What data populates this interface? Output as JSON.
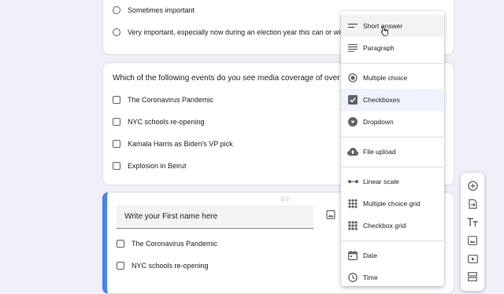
{
  "card1": {
    "options": [
      "Sometimes important",
      "Very important, especially now during an election year this can or will affe"
    ]
  },
  "card2": {
    "question": "Which of the following events do you see media coverage of over the",
    "options": [
      "The Coronavirus Pandemic",
      "NYC schools re-opening",
      "Kamala Harris as Biden's VP pick",
      "Explosion in Beirut"
    ]
  },
  "card3": {
    "drag_handle": "⠿⠿",
    "question_value": "Write your First name here",
    "options": [
      "The Coronavirus Pandemic",
      "NYC schools re-opening"
    ]
  },
  "type_menu": {
    "items": [
      {
        "label": "Short answer",
        "icon": "short-answer-icon"
      },
      {
        "label": "Paragraph",
        "icon": "paragraph-icon"
      },
      {
        "label": "Multiple choice",
        "icon": "radio-icon"
      },
      {
        "label": "Checkboxes",
        "icon": "checkbox-icon"
      },
      {
        "label": "Dropdown",
        "icon": "dropdown-icon"
      },
      {
        "label": "File upload",
        "icon": "upload-icon"
      },
      {
        "label": "Linear scale",
        "icon": "linear-scale-icon"
      },
      {
        "label": "Multiple choice grid",
        "icon": "grid-icon"
      },
      {
        "label": "Checkbox grid",
        "icon": "grid-icon"
      },
      {
        "label": "Date",
        "icon": "calendar-icon"
      },
      {
        "label": "Time",
        "icon": "clock-icon"
      }
    ],
    "selected": "Checkboxes",
    "hovered": "Short answer"
  },
  "side_toolbar": {
    "buttons": [
      "add-question-icon",
      "import-questions-icon",
      "add-title-icon",
      "add-image-icon",
      "add-video-icon",
      "add-section-icon"
    ]
  },
  "colors": {
    "background": "#f1eef8",
    "accent": "#4285f4",
    "icon": "#5f6368"
  }
}
